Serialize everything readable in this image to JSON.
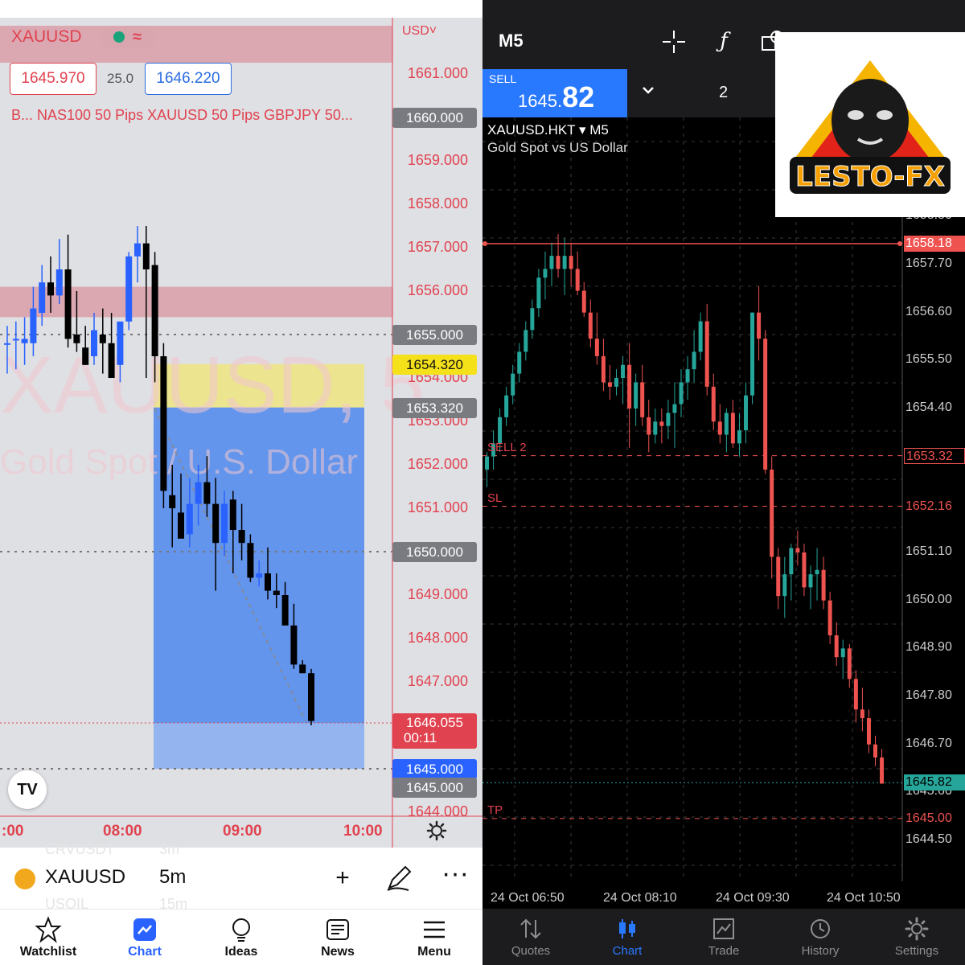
{
  "left": {
    "header": {
      "symbol": "XAUUSD",
      "wave_glyph": "≈",
      "currency": "USD",
      "bid": "1645.970",
      "spread": "25.0",
      "ask": "1646.220",
      "indicators": "B...  NAS100 50 Pips XAUUSD 50 Pips GBPJPY 50..."
    },
    "watermark": {
      "line1": "XAUUSD, 5",
      "line2": "Gold Spot / U.S. Dollar"
    },
    "axis_ticks": [
      "1661.000",
      "1660.000",
      "1659.000",
      "1658.000",
      "1657.000",
      "1656.000",
      "1655.000",
      "1654.000",
      "1653.000",
      "1652.000",
      "1651.000",
      "1650.000",
      "1649.000",
      "1648.000",
      "1647.000",
      "1646.000",
      "1645.000",
      "1644.000"
    ],
    "price_labels": {
      "l1660": "1660.000",
      "l1655": "1655.000",
      "stop": "1654.320",
      "entry": "1653.320",
      "l1650": "1650.000",
      "last": "1646.055",
      "countdown": "00:11",
      "target": "1645.000",
      "l1645": "1645.000"
    },
    "time_axis": [
      ":00",
      "08:00",
      "09:00",
      "10:00"
    ],
    "logo_text": "TV",
    "symbol_bar": {
      "symbol": "XAUUSD",
      "timeframe": "5m",
      "ghost_above": "CRVUSDT",
      "ghost_above_tf": "3m",
      "ghost_below": "USOIL",
      "ghost_below_tf": "15m",
      "add_icon": "plus-icon",
      "draw_icon": "pen-icon",
      "more_icon": "more-icon"
    },
    "tabs": [
      {
        "label": "Watchlist",
        "icon": "star-icon"
      },
      {
        "label": "Chart",
        "icon": "chart-icon",
        "active": true
      },
      {
        "label": "Ideas",
        "icon": "bulb-icon"
      },
      {
        "label": "News",
        "icon": "news-icon"
      },
      {
        "label": "Menu",
        "icon": "menu-icon"
      }
    ],
    "colors": {
      "up": "#2962ff",
      "down": "#000000",
      "red": "#e0424f",
      "blue_zone": "#6495ec",
      "yellow_zone": "#ece48f"
    }
  },
  "right": {
    "timeframe": "M5",
    "sell_label": "SELL",
    "sell_price_prefix": "1645.",
    "sell_price_big": "82",
    "lots": "2",
    "symbol": "XAUUSD.HKT",
    "symbol_tf": "M5",
    "symbol_desc": "Gold Spot vs US Dollar",
    "axis_ticks": [
      "1658.80",
      "1657.70",
      "1656.60",
      "1655.50",
      "1654.40",
      "1651.10",
      "1650.00",
      "1648.90",
      "1647.80",
      "1646.70",
      "1645.60",
      "1644.50"
    ],
    "boxes": {
      "high": "1658.18",
      "sell": "1653.32",
      "sl": "1652.16",
      "current": "1645.82",
      "tp": "1645.00"
    },
    "line_labels": {
      "sell": "SELL 2",
      "sl": "SL",
      "tp": "TP"
    },
    "time_axis": [
      "24 Oct 06:50",
      "24 Oct 08:10",
      "24 Oct 09:30",
      "24 Oct 10:50"
    ],
    "logo_text": "LESTO-FX",
    "tabs": [
      {
        "label": "Quotes",
        "icon": "quotes-icon"
      },
      {
        "label": "Chart",
        "icon": "candles-icon",
        "active": true
      },
      {
        "label": "Trade",
        "icon": "trade-icon"
      },
      {
        "label": "History",
        "icon": "history-icon"
      },
      {
        "label": "Settings",
        "icon": "settings-icon"
      }
    ],
    "colors": {
      "up": "#26a69a",
      "down": "#ef5350",
      "bg": "#000000",
      "accent": "#2979ff"
    }
  },
  "chart_data": [
    {
      "type": "candlestick",
      "title": "XAUUSD, 5",
      "ylim": [
        1643.8,
        1661.8
      ],
      "series": [
        {
          "name": "XAUUSD",
          "ohlc": [
            [
              1654.8,
              1655.2,
              1654.1,
              1654.8
            ],
            [
              1654.9,
              1655.3,
              1654.2,
              1654.9
            ],
            [
              1654.8,
              1655.4,
              1654.3,
              1654.9
            ],
            [
              1654.8,
              1656.1,
              1654.5,
              1655.6
            ],
            [
              1655.5,
              1656.6,
              1655.2,
              1656.2
            ],
            [
              1656.2,
              1656.8,
              1655.5,
              1655.9
            ],
            [
              1655.9,
              1657.2,
              1655.7,
              1656.5
            ],
            [
              1656.5,
              1657.3,
              1654.7,
              1654.9
            ],
            [
              1655.0,
              1656.0,
              1654.6,
              1654.8
            ],
            [
              1654.7,
              1655.2,
              1654.3,
              1654.3
            ],
            [
              1654.5,
              1655.5,
              1654.3,
              1655.1
            ],
            [
              1655.0,
              1655.6,
              1654.1,
              1654.8
            ],
            [
              1654.8,
              1655.5,
              1654.0,
              1654.0
            ],
            [
              1654.3,
              1655.0,
              1653.9,
              1655.3
            ],
            [
              1655.3,
              1656.9,
              1655.1,
              1656.8
            ],
            [
              1656.8,
              1657.5,
              1656.2,
              1657.1
            ],
            [
              1657.1,
              1657.5,
              1654.0,
              1656.5
            ],
            [
              1656.6,
              1656.9,
              1653.9,
              1654.5
            ],
            [
              1654.5,
              1654.8,
              1651.0,
              1651.4
            ],
            [
              1651.3,
              1652.0,
              1650.1,
              1651.0
            ],
            [
              1650.9,
              1651.8,
              1650.6,
              1650.3
            ],
            [
              1650.4,
              1651.7,
              1650.1,
              1651.1
            ],
            [
              1651.1,
              1652.0,
              1650.6,
              1651.6
            ],
            [
              1651.6,
              1652.2,
              1650.8,
              1651.1
            ],
            [
              1651.1,
              1651.7,
              1649.1,
              1650.2
            ],
            [
              1650.2,
              1651.4,
              1649.9,
              1651.1
            ],
            [
              1651.2,
              1651.4,
              1649.5,
              1650.5
            ],
            [
              1650.5,
              1651.1,
              1649.8,
              1650.2
            ],
            [
              1650.2,
              1650.4,
              1649.3,
              1649.4
            ],
            [
              1649.4,
              1649.8,
              1649.2,
              1649.5
            ],
            [
              1649.5,
              1650.1,
              1648.9,
              1649.1
            ],
            [
              1649.1,
              1649.5,
              1648.7,
              1649.0
            ],
            [
              1649.0,
              1649.3,
              1648.6,
              1648.3
            ],
            [
              1648.3,
              1648.8,
              1647.3,
              1647.4
            ],
            [
              1647.4,
              1647.5,
              1647.2,
              1647.2
            ],
            [
              1647.2,
              1647.3,
              1646.0,
              1646.1
            ]
          ]
        }
      ],
      "annotations": {
        "short_entry": 1653.32,
        "stop": 1654.32,
        "target": 1645.0,
        "last": 1646.055
      }
    },
    {
      "type": "candlestick",
      "title": "XAUUSD.HKT M5",
      "ylim": [
        1644.2,
        1659.2
      ],
      "series": [
        {
          "name": "XAUUSD.HKT",
          "ohlc": [
            [
              1653.0,
              1653.4,
              1652.6,
              1653.3
            ],
            [
              1653.3,
              1653.9,
              1653.0,
              1653.6
            ],
            [
              1653.6,
              1654.4,
              1653.4,
              1654.2
            ],
            [
              1654.2,
              1654.9,
              1654.0,
              1654.7
            ],
            [
              1654.7,
              1655.4,
              1654.5,
              1655.2
            ],
            [
              1655.2,
              1655.9,
              1655.0,
              1655.7
            ],
            [
              1655.7,
              1656.4,
              1655.5,
              1656.2
            ],
            [
              1656.2,
              1656.9,
              1656.0,
              1656.7
            ],
            [
              1656.7,
              1657.6,
              1656.5,
              1657.4
            ],
            [
              1657.4,
              1658.0,
              1656.9,
              1657.6
            ],
            [
              1657.6,
              1658.2,
              1657.2,
              1657.9
            ],
            [
              1657.9,
              1658.4,
              1657.4,
              1657.6
            ],
            [
              1657.6,
              1658.3,
              1657.0,
              1657.9
            ],
            [
              1657.9,
              1658.2,
              1657.2,
              1657.6
            ],
            [
              1657.6,
              1658.0,
              1657.0,
              1657.1
            ],
            [
              1657.1,
              1657.3,
              1656.5,
              1656.6
            ],
            [
              1656.6,
              1656.9,
              1655.8,
              1656.0
            ],
            [
              1656.0,
              1656.6,
              1655.4,
              1655.6
            ],
            [
              1655.6,
              1656.0,
              1654.8,
              1655.0
            ],
            [
              1655.0,
              1655.4,
              1654.6,
              1654.9
            ],
            [
              1654.9,
              1655.3,
              1654.7,
              1655.1
            ],
            [
              1655.1,
              1655.6,
              1654.5,
              1655.4
            ],
            [
              1655.4,
              1655.9,
              1653.5,
              1654.4
            ],
            [
              1654.4,
              1655.2,
              1654.0,
              1655.0
            ],
            [
              1655.0,
              1655.4,
              1654.0,
              1654.2
            ],
            [
              1654.2,
              1654.6,
              1653.4,
              1653.8
            ],
            [
              1653.8,
              1654.4,
              1653.6,
              1654.1
            ],
            [
              1654.1,
              1654.4,
              1653.6,
              1654.0
            ],
            [
              1654.0,
              1654.6,
              1653.7,
              1654.3
            ],
            [
              1654.3,
              1655.0,
              1653.5,
              1654.5
            ],
            [
              1654.5,
              1655.3,
              1654.2,
              1655.0
            ],
            [
              1655.0,
              1655.6,
              1654.6,
              1655.3
            ],
            [
              1655.3,
              1656.2,
              1655.0,
              1655.7
            ],
            [
              1655.7,
              1656.6,
              1655.5,
              1656.4
            ],
            [
              1656.4,
              1656.8,
              1654.7,
              1654.9
            ],
            [
              1654.9,
              1655.2,
              1653.9,
              1654.1
            ],
            [
              1654.1,
              1654.5,
              1653.6,
              1653.8
            ],
            [
              1653.8,
              1654.4,
              1653.4,
              1654.3
            ],
            [
              1654.3,
              1654.6,
              1653.5,
              1653.6
            ],
            [
              1653.6,
              1654.3,
              1653.3,
              1653.9
            ],
            [
              1653.9,
              1655.0,
              1653.6,
              1654.7
            ],
            [
              1654.7,
              1656.6,
              1654.5,
              1656.6
            ],
            [
              1656.6,
              1657.2,
              1655.5,
              1656.0
            ],
            [
              1656.0,
              1656.2,
              1652.9,
              1653.0
            ],
            [
              1653.0,
              1653.3,
              1650.5,
              1651.0
            ],
            [
              1651.0,
              1651.2,
              1649.8,
              1650.1
            ],
            [
              1650.1,
              1651.0,
              1649.6,
              1650.6
            ],
            [
              1650.6,
              1651.3,
              1650.0,
              1651.2
            ],
            [
              1651.2,
              1651.6,
              1650.8,
              1651.1
            ],
            [
              1651.1,
              1651.3,
              1650.1,
              1650.3
            ],
            [
              1650.3,
              1650.8,
              1649.8,
              1650.6
            ],
            [
              1650.6,
              1651.2,
              1650.0,
              1650.7
            ],
            [
              1650.7,
              1651.0,
              1649.8,
              1650.0
            ],
            [
              1650.0,
              1650.2,
              1649.0,
              1649.2
            ],
            [
              1649.2,
              1649.5,
              1648.5,
              1648.7
            ],
            [
              1648.7,
              1649.1,
              1648.2,
              1648.9
            ],
            [
              1648.9,
              1649.0,
              1648.0,
              1648.2
            ],
            [
              1648.2,
              1648.4,
              1647.2,
              1647.5
            ],
            [
              1647.5,
              1648.0,
              1647.0,
              1647.3
            ],
            [
              1647.3,
              1647.5,
              1646.5,
              1646.7
            ],
            [
              1646.7,
              1646.9,
              1646.2,
              1646.4
            ],
            [
              1646.4,
              1646.6,
              1645.8,
              1645.8
            ]
          ]
        }
      ],
      "annotations": {
        "high": 1658.18,
        "sell": 1653.32,
        "sl": 1652.16,
        "tp": 1645.0,
        "current": 1645.82
      }
    }
  ]
}
